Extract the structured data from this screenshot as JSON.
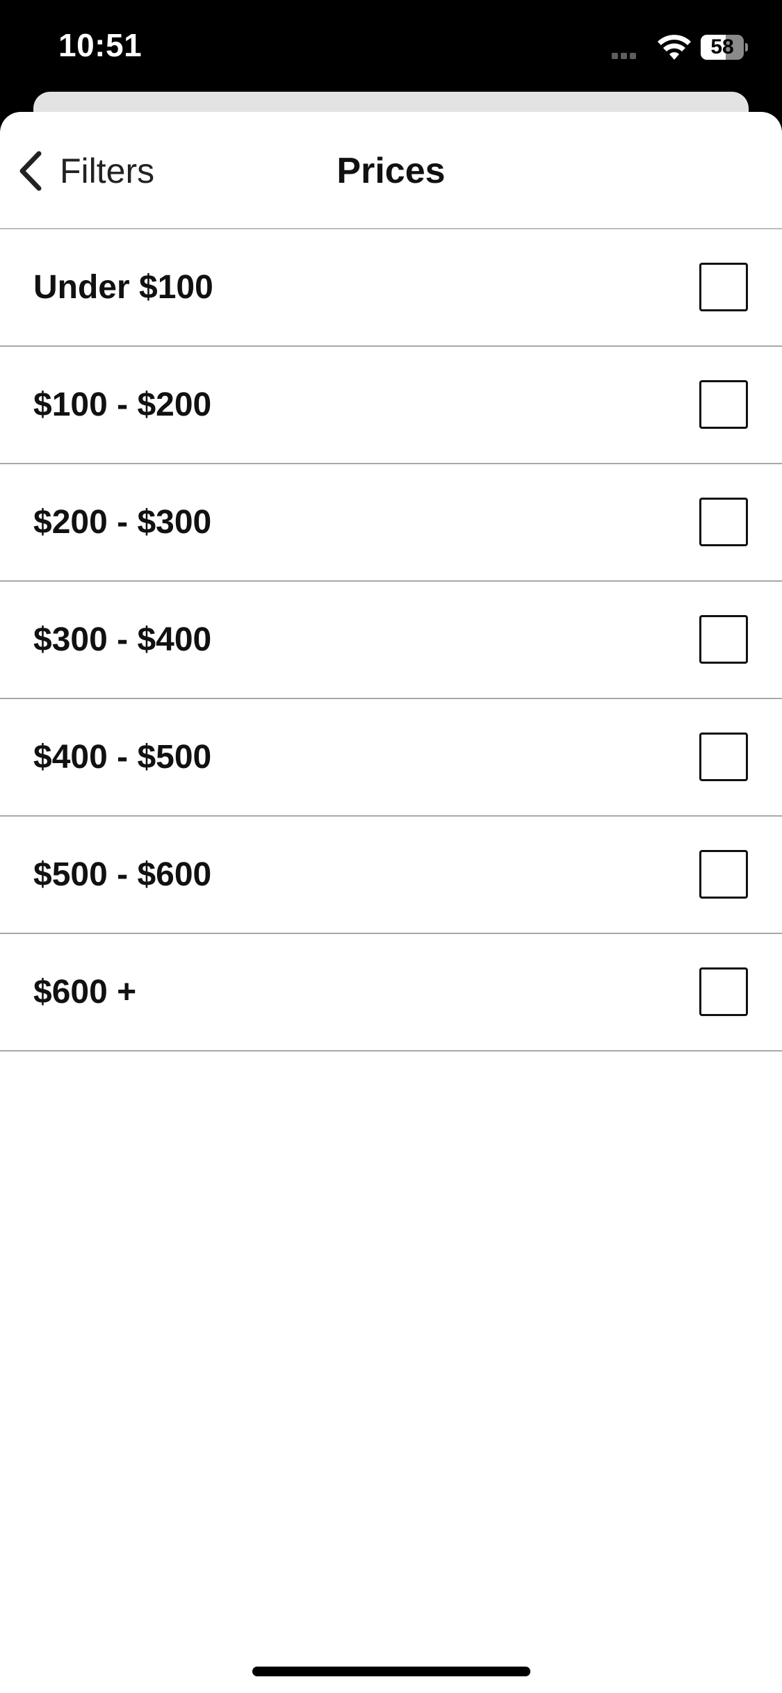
{
  "status_bar": {
    "time": "10:51",
    "battery_level": "58",
    "icons": [
      "cellular-signal-icon",
      "wifi-icon",
      "battery-icon"
    ]
  },
  "nav": {
    "back_label": "Filters",
    "back_icon": "chevron-left-icon",
    "title": "Prices"
  },
  "prices": [
    {
      "label": "Under $100",
      "checked": false
    },
    {
      "label": "$100 - $200",
      "checked": false
    },
    {
      "label": "$200 - $300",
      "checked": false
    },
    {
      "label": "$300 - $400",
      "checked": false
    },
    {
      "label": "$400 - $500",
      "checked": false
    },
    {
      "label": "$500 - $600",
      "checked": false
    },
    {
      "label": "$600 +",
      "checked": false
    }
  ],
  "colors": {
    "status_bar_background": "#000000",
    "sheet_background": "#ffffff",
    "text": "#111111",
    "divider": "#a8a8a8"
  }
}
